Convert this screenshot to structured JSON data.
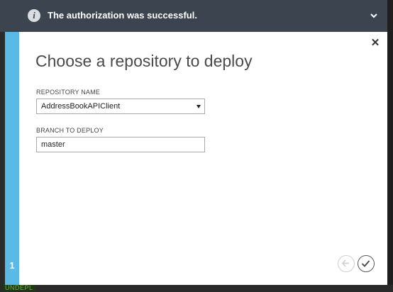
{
  "notification": {
    "message": "The authorization was successful.",
    "info_icon_glyph": "i",
    "icon": "info-icon"
  },
  "dialog": {
    "close_glyph": "✕",
    "title": "Choose a repository to deploy",
    "step_number": "1",
    "repository": {
      "label": "REPOSITORY NAME",
      "selected_value": "AddressBookAPIClient"
    },
    "branch": {
      "label": "BRANCH TO DEPLOY",
      "value": "master"
    },
    "buttons": {
      "back": "back-arrow-icon",
      "complete": "checkmark-icon"
    }
  },
  "background": {
    "bottom_text": "UNDEPL"
  },
  "colors": {
    "notification_bar": "#3c454f",
    "step_rail": "#5bb9e6",
    "dialog_bg": "#ffffff"
  }
}
